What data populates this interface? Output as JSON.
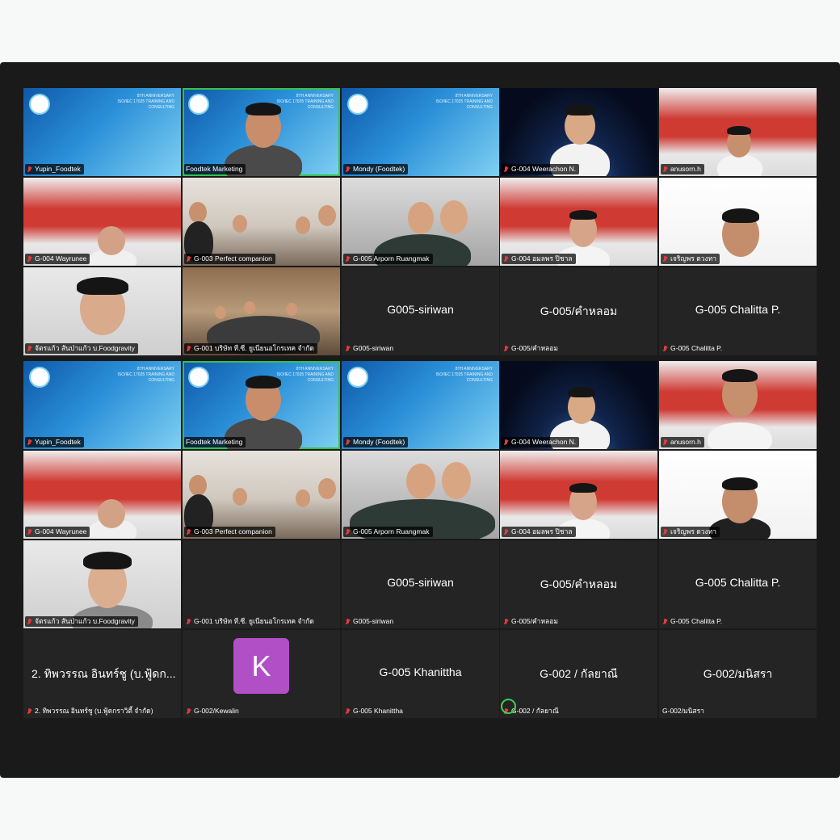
{
  "colors": {
    "background": "#f7f8f8",
    "meeting_bg": "#1a1a1a",
    "tile_empty": "#242424",
    "active_speaker": "#32c24d",
    "avatar": "#b150c6",
    "muted_icon": "#e23b3b"
  },
  "gallery": {
    "top": {
      "r1": [
        {
          "name": "Yupin_Foodtek"
        },
        {
          "name": "Foodtek Marketing"
        },
        {
          "name": "Mondy (Foodtek)"
        },
        {
          "name": "G-004 Weerachon N."
        },
        {
          "name": "anusorn.h"
        }
      ],
      "r2": [
        {
          "name": "G-004 Wayrunee"
        },
        {
          "name": "G-003 Perfect companion"
        },
        {
          "name": "G-005 Arporn Ruangmak"
        },
        {
          "name": "G-004 อมลพร ปิชาล"
        },
        {
          "name": "เจริญพร ดวงทา"
        }
      ],
      "r3": [
        {
          "name": "จัตรแก้ว สันป่าแก้ว บ.Foodgravity"
        },
        {
          "name": "G-001 บริษัท ที.ซี. ยูเนียนอโกรเทค จำกัด"
        },
        {
          "name": "G005-siriwan",
          "display": "G005-siriwan"
        },
        {
          "name": "G-005/คำหลอม",
          "display": "G-005/คำหลอม"
        },
        {
          "name": "G-005 Chalitta P.",
          "display": "G-005 Chalitta P."
        }
      ]
    },
    "bottom": {
      "r1": [
        {
          "name": "Yupin_Foodtek"
        },
        {
          "name": "Foodtek Marketing"
        },
        {
          "name": "Mondy (Foodtek)"
        },
        {
          "name": "G-004 Weerachon N."
        },
        {
          "name": "anusorn.h"
        }
      ],
      "r2": [
        {
          "name": "G-004 Wayrunee"
        },
        {
          "name": "G-003 Perfect companion"
        },
        {
          "name": "G-005 Arporn Ruangmak"
        },
        {
          "name": "G-004 อมลพร ปิชาล"
        },
        {
          "name": "เจริญพร ดวงทา"
        }
      ],
      "r3": [
        {
          "name": "จัตรแก้ว สันป่าแก้ว บ.Foodgravity"
        },
        {
          "name": "G-001 บริษัท ที.ซี. ยูเนียนอโกรเทค จำกัด"
        },
        {
          "name": "G005-siriwan",
          "display": "G005-siriwan"
        },
        {
          "name": "G-005/คำหลอม",
          "display": "G-005/คำหลอม"
        },
        {
          "name": "G-005 Chalitta P.",
          "display": "G-005 Chalitta P."
        }
      ],
      "r4": [
        {
          "name": "2. ทิพวรรณ อินทร์ชู (บ.ฟู้ดกราวิตี้ จำกัด)",
          "display": "2. ทิพวรรณ อินทร์ชู (บ.ฟู้ดก..."
        },
        {
          "name": "G-002/Kewalin",
          "avatar_letter": "K"
        },
        {
          "name": "G-005 Khanittha",
          "display": "G-005 Khanittha"
        },
        {
          "name": "G-002 / กัลยาณี",
          "display": "G-002 / กัลยาณี"
        },
        {
          "name": "G-002/มนิสรา",
          "display": "G-002/มนิสรา"
        }
      ]
    }
  },
  "banner": {
    "line1": "8TH ANNIVERSARY",
    "line2": "ISO/IEC 17025 TRAINING AND CONSULTING"
  }
}
